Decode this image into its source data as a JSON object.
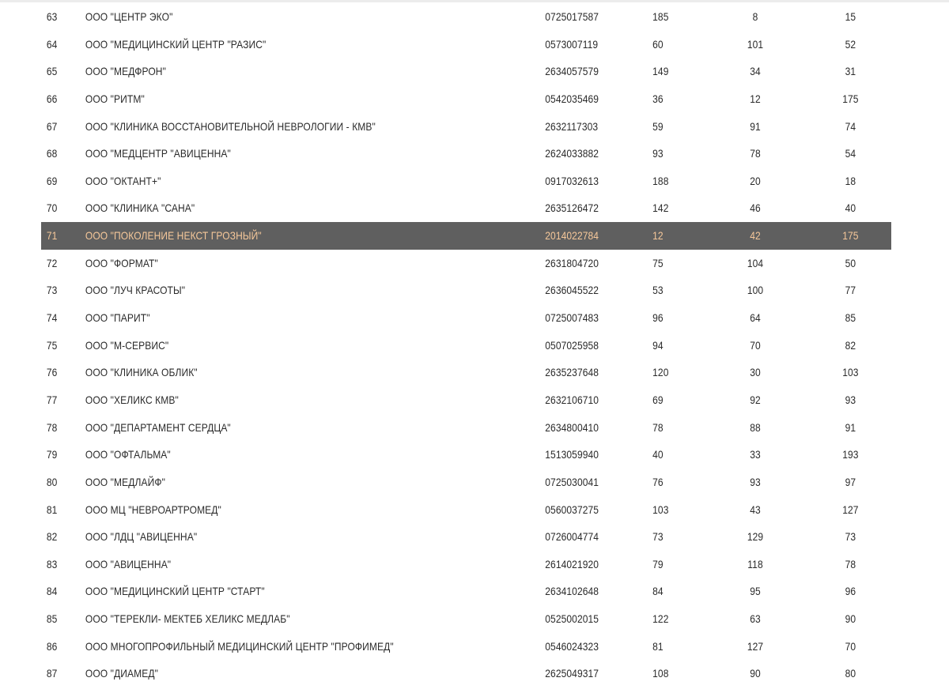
{
  "table": {
    "rows": [
      {
        "num": "63",
        "name": "ООО \"ЦЕНТР ЭКО\"",
        "inn": "0725017587",
        "a": "185",
        "b": "8",
        "c": "15"
      },
      {
        "num": "64",
        "name": "ООО \"МЕДИЦИНСКИЙ ЦЕНТР \"РАЗИС\"",
        "inn": "0573007119",
        "a": "60",
        "b": "101",
        "c": "52"
      },
      {
        "num": "65",
        "name": "ООО \"МЕДФРОН\"",
        "inn": "2634057579",
        "a": "149",
        "b": "34",
        "c": "31"
      },
      {
        "num": "66",
        "name": "ООО \"РИТМ\"",
        "inn": "0542035469",
        "a": "36",
        "b": "12",
        "c": "175"
      },
      {
        "num": "67",
        "name": "ООО \"КЛИНИКА ВОССТАНОВИТЕЛЬНОЙ НЕВРОЛОГИИ - КМВ\"",
        "inn": "2632117303",
        "a": "59",
        "b": "91",
        "c": "74"
      },
      {
        "num": "68",
        "name": "ООО \"МЕДЦЕНТР \"АВИЦЕННА\"",
        "inn": "2624033882",
        "a": "93",
        "b": "78",
        "c": "54"
      },
      {
        "num": "69",
        "name": "ООО \"ОКТАНТ+\"",
        "inn": "0917032613",
        "a": "188",
        "b": "20",
        "c": "18"
      },
      {
        "num": "70",
        "name": "ООО \"КЛИНИКА \"САНА\"",
        "inn": "2635126472",
        "a": "142",
        "b": "46",
        "c": "40"
      },
      {
        "num": "71",
        "name": "ООО \"ПОКОЛЕНИЕ НЕКСТ ГРОЗНЫЙ\"",
        "inn": "2014022784",
        "a": "12",
        "b": "42",
        "c": "175",
        "highlight": true
      },
      {
        "num": "72",
        "name": "ООО \"ФОРМАТ\"",
        "inn": "2631804720",
        "a": "75",
        "b": "104",
        "c": "50"
      },
      {
        "num": "73",
        "name": "ООО \"ЛУЧ КРАСОТЫ\"",
        "inn": "2636045522",
        "a": "53",
        "b": "100",
        "c": "77"
      },
      {
        "num": "74",
        "name": "ООО \"ПАРИТ\"",
        "inn": "0725007483",
        "a": "96",
        "b": "64",
        "c": "85"
      },
      {
        "num": "75",
        "name": "ООО \"М-СЕРВИС\"",
        "inn": "0507025958",
        "a": "94",
        "b": "70",
        "c": "82"
      },
      {
        "num": "76",
        "name": "ООО \"КЛИНИКА ОБЛИК\"",
        "inn": "2635237648",
        "a": "120",
        "b": "30",
        "c": "103"
      },
      {
        "num": "77",
        "name": "ООО \"ХЕЛИКС КМВ\"",
        "inn": "2632106710",
        "a": "69",
        "b": "92",
        "c": "93"
      },
      {
        "num": "78",
        "name": "ООО \"ДЕПАРТАМЕНТ СЕРДЦА\"",
        "inn": "2634800410",
        "a": "78",
        "b": "88",
        "c": "91"
      },
      {
        "num": "79",
        "name": "ООО \"ОФТАЛЬМА\"",
        "inn": "1513059940",
        "a": "40",
        "b": "33",
        "c": "193"
      },
      {
        "num": "80",
        "name": "ООО \"МЕДЛАЙФ\"",
        "inn": "0725030041",
        "a": "76",
        "b": "93",
        "c": "97"
      },
      {
        "num": "81",
        "name": "ООО МЦ \"НЕВРОАРТРОМЕД\"",
        "inn": "0560037275",
        "a": "103",
        "b": "43",
        "c": "127"
      },
      {
        "num": "82",
        "name": "ООО \"ЛДЦ \"АВИЦЕННА\"",
        "inn": "0726004774",
        "a": "73",
        "b": "129",
        "c": "73"
      },
      {
        "num": "83",
        "name": "ООО \"АВИЦЕННА\"",
        "inn": "2614021920",
        "a": "79",
        "b": "118",
        "c": "78"
      },
      {
        "num": "84",
        "name": "ООО \"МЕДИЦИНСКИЙ ЦЕНТР \"СТАРТ\"",
        "inn": "2634102648",
        "a": "84",
        "b": "95",
        "c": "96"
      },
      {
        "num": "85",
        "name": "ООО \"ТЕРЕКЛИ- МЕКТЕБ ХЕЛИКС МЕДЛАБ\"",
        "inn": "0525002015",
        "a": "122",
        "b": "63",
        "c": "90"
      },
      {
        "num": "86",
        "name": "ООО МНОГОПРОФИЛЬНЫЙ МЕДИЦИНСКИЙ ЦЕНТР \"ПРОФИМЕД\"",
        "inn": "0546024323",
        "a": "81",
        "b": "127",
        "c": "70"
      },
      {
        "num": "87",
        "name": "ООО \"ДИАМЕД\"",
        "inn": "2625049317",
        "a": "108",
        "b": "90",
        "c": "80"
      }
    ]
  },
  "colors": {
    "highlight_bg": "#5f5f5f",
    "highlight_text": "#f6c89a",
    "text": "#2a2a2a"
  }
}
